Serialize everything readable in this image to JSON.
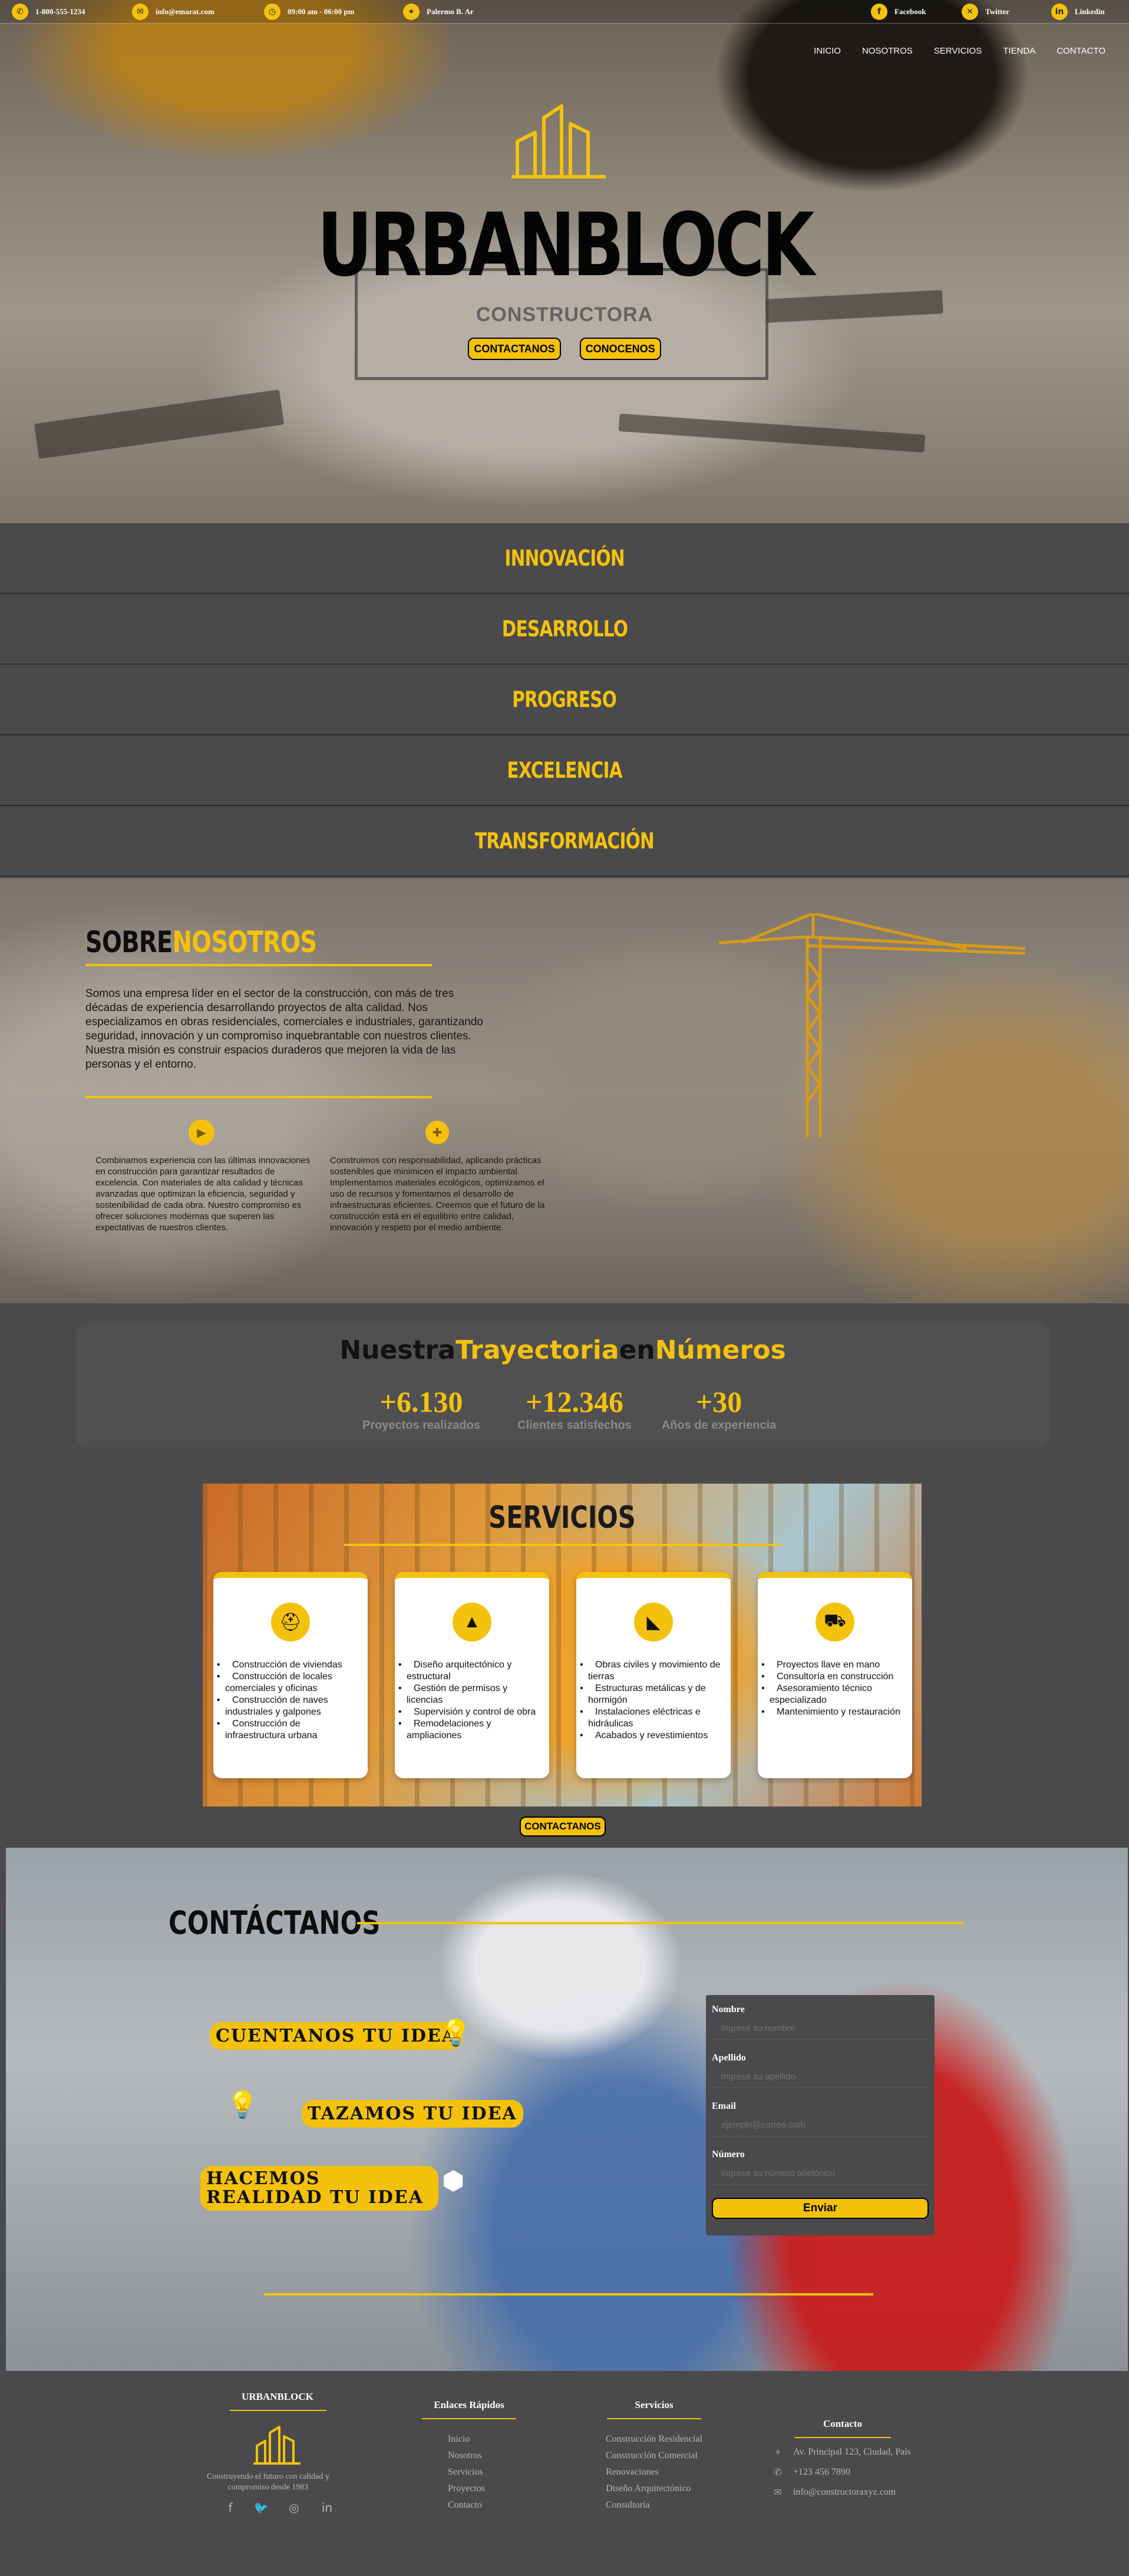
{
  "topbar": {
    "phone": "1-800-555-1234",
    "email": "info@emarat.com",
    "hours": "09:00 am - 06:00 pm",
    "location": "Palermo B. Ar",
    "social": [
      "Facebook",
      "Twitter",
      "Linkedin"
    ]
  },
  "nav": [
    "INICIO",
    "NOSOTROS",
    "SERVICIOS",
    "TIENDA",
    "CONTACTO"
  ],
  "hero": {
    "brand": "URBANBLOCK",
    "subtitle": "CONSTRUCTORA",
    "buttons": [
      "CONTACTANOS",
      "CONOCENOS"
    ]
  },
  "values": [
    "INNOVACIÓN",
    "DESARROLLO",
    "PROGRESO",
    "EXCELENCIA",
    "TRANSFORMACIÓN"
  ],
  "about": {
    "title_a": "SOBRE",
    "title_b": "NOSOTROS",
    "text": "Somos una empresa líder en el sector de la construcción, con más de tres décadas de experiencia desarrollando proyectos de alta calidad. Nos especializamos en obras residenciales, comerciales e industriales, garantizando seguridad, innovación y un compromiso inquebrantable con nuestros clientes. Nuestra misión es construir espacios duraderos que mejoren la vida de las personas y el entorno.",
    "col1": "Combinamos experiencia con las últimas innovaciones en construcción para garantizar resultados de excelencia. Con materiales de alta calidad y técnicas avanzadas que optimizan la eficiencia, seguridad y sostenibilidad de cada obra. Nuestro compromiso es ofrecer soluciones modernas que superen las expectativas de nuestros clientes.",
    "col2": "Construimos con responsabilidad, aplicando prácticas sostenibles que minimicen el impacto ambiental. Implementamos materiales ecológicos, optimizamos el uso de recursos y fomentamos el desarrollo de infraestructuras eficientes. Creemos que el futuro de la construcción está en el equilibrio entre calidad, innovación y respeto por el medio ambiente."
  },
  "stats": {
    "title_a": "Nuestra",
    "title_b": "Trayectoria",
    "title_c": "en",
    "title_d": "Números",
    "items": [
      {
        "num": "+6.130",
        "label": "Proyectos realizados"
      },
      {
        "num": "+12.346",
        "label": "Clientes satisfechos"
      },
      {
        "num": "+30",
        "label": "Años de experiencia"
      }
    ]
  },
  "services": {
    "title": "SERVICIOS",
    "cards": [
      {
        "icon": "helmet-icon",
        "items": [
          "Construcción de viviendas",
          "Construcción de locales comerciales y oficinas",
          "Construcción de naves industriales y galpones",
          "Construcción de infraestructura urbana"
        ]
      },
      {
        "icon": "traffic-cone-icon",
        "items": [
          "Diseño arquitectónico y estructural",
          "Gestión de permisos y licencias",
          "Supervisión y control de obra",
          "Remodelaciones y ampliaciones"
        ]
      },
      {
        "icon": "ruler-set-icon",
        "items": [
          "Obras civiles y movimiento de tierras",
          "Estructuras metálicas y de hormigón",
          "Instalaciones eléctricas e hidráulicas",
          "Acabados y revestimientos"
        ]
      },
      {
        "icon": "wheelbarrow-icon",
        "items": [
          "Proyectos llave en mano",
          "Consultoría en construcción",
          "Asesoramiento técnico especializado",
          "Mantenimiento y restauración"
        ]
      }
    ],
    "button": "CONTACTANOS"
  },
  "contact": {
    "title": "CONTÁCTANOS",
    "steps": [
      "CUENTANOS TU IDEA",
      "TAZAMOS TU IDEA",
      "HACEMOS REALIDAD TU IDEA"
    ],
    "form": {
      "name_label": "Nombre",
      "name_placeholder": "Ingrese su nombre",
      "last_label": "Apellido",
      "last_placeholder": "Ingrese su apellido",
      "email_label": "Email",
      "email_placeholder": "ejemplo@correo.com",
      "phone_label": "Número",
      "phone_placeholder": "Ingrese su número telefónico",
      "submit": "Enviar"
    }
  },
  "footer": {
    "brand": "URBANBLOCK",
    "tagline": "Construyendo el futuro con calidad y compromiso desde 1983",
    "links_title": "Enlaces Rápidos",
    "links": [
      "Inicio",
      "Nosotros",
      "Servicios",
      "Proyectos",
      "Contacto"
    ],
    "services_title": "Servicios",
    "services": [
      "Construcción Residencial",
      "Construcción Comercial",
      "Renovaciones",
      "Diseño Arquitectónico",
      "Consultoría"
    ],
    "contact_title": "Contacto",
    "address": "Av. Principal 123, Ciudad, País",
    "phone": "+123 456 7890",
    "email": "info@constructoraxyz.com"
  },
  "colors": {
    "accent": "#f4c20d",
    "background": "#4a4a4c"
  }
}
